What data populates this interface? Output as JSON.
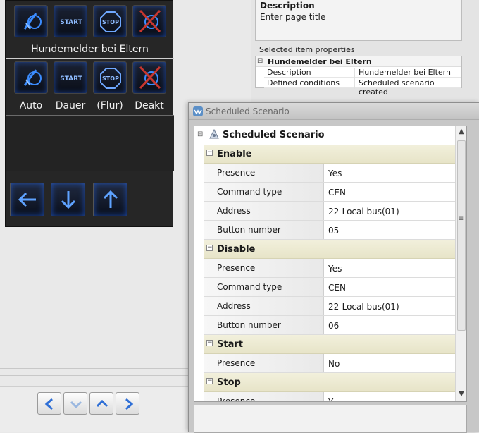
{
  "device": {
    "top_caption": "Hundemelder bei Eltern",
    "row1_icons": [
      "mode-auto-icon",
      "start-icon",
      "stop-icon",
      "deactivate-icon"
    ],
    "row2_icons": [
      "mode-auto-icon",
      "start-icon",
      "stop-icon",
      "deactivate-icon"
    ],
    "start_text": "START",
    "stop_text": "STOP",
    "row2_labels": [
      "Auto",
      "Dauer",
      "(Flur)",
      "Deakt"
    ],
    "arrows": [
      "arrow-left-icon",
      "arrow-down-icon",
      "arrow-up-icon"
    ]
  },
  "bottom_nav": [
    "chevron-left-icon",
    "chevron-down-icon",
    "chevron-up-icon",
    "chevron-right-icon"
  ],
  "properties_panel": {
    "description_title": "Description",
    "description_value": "Enter page title",
    "selected_label": "Selected item properties",
    "item_name": "Hundemelder bei Eltern",
    "rows": [
      {
        "key": "Description",
        "value": "Hundemelder bei Eltern"
      },
      {
        "key": "Defined conditions",
        "value": "Scheduled scenario created"
      }
    ]
  },
  "window": {
    "title": "Scheduled Scenario",
    "root": "Scheduled Scenario",
    "sections": [
      {
        "name": "Enable",
        "rows": [
          {
            "key": "Presence",
            "value": "Yes"
          },
          {
            "key": "Command type",
            "value": "CEN"
          },
          {
            "key": "Address",
            "value": "22-Local bus(01)"
          },
          {
            "key": "Button number",
            "value": "05"
          }
        ]
      },
      {
        "name": "Disable",
        "rows": [
          {
            "key": "Presence",
            "value": "Yes"
          },
          {
            "key": "Command type",
            "value": "CEN"
          },
          {
            "key": "Address",
            "value": "22-Local bus(01)"
          },
          {
            "key": "Button number",
            "value": "06"
          }
        ]
      },
      {
        "name": "Start",
        "rows": [
          {
            "key": "Presence",
            "value": "No"
          }
        ]
      },
      {
        "name": "Stop",
        "rows": [
          {
            "key": "Presence",
            "value": "Y"
          }
        ]
      }
    ]
  },
  "colors": {
    "category_band": "#ece9d0",
    "device_glow": "#2a6cff",
    "device_bg": "#262626"
  }
}
